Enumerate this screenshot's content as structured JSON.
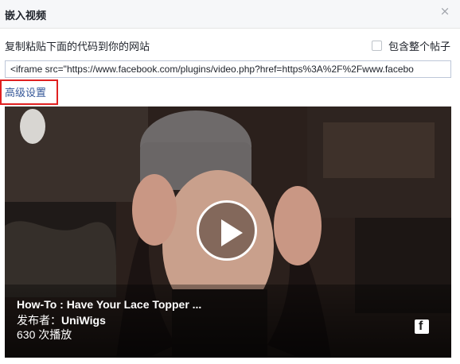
{
  "dialog": {
    "title": "嵌入视频",
    "close_glyph": "×"
  },
  "instructions": "复制粘贴下面的代码到你的网站",
  "include_post": {
    "label": "包含整个帖子",
    "checked": false
  },
  "embed_code": "<iframe src=\"https://www.facebook.com/plugins/video.php?href=https%3A%2F%2Fwww.facebo",
  "advanced_settings": "高级设置",
  "video": {
    "title": "How-To : Have Your Lace Topper ...",
    "publisher_label": "发布者：",
    "publisher_name": "UniWigs",
    "views": "630 次播放",
    "play_icon": "play-icon",
    "brand_icon": "facebook-icon"
  },
  "colors": {
    "link": "#365899",
    "highlight_border": "#e02020",
    "header_bg": "#f6f7f9"
  }
}
